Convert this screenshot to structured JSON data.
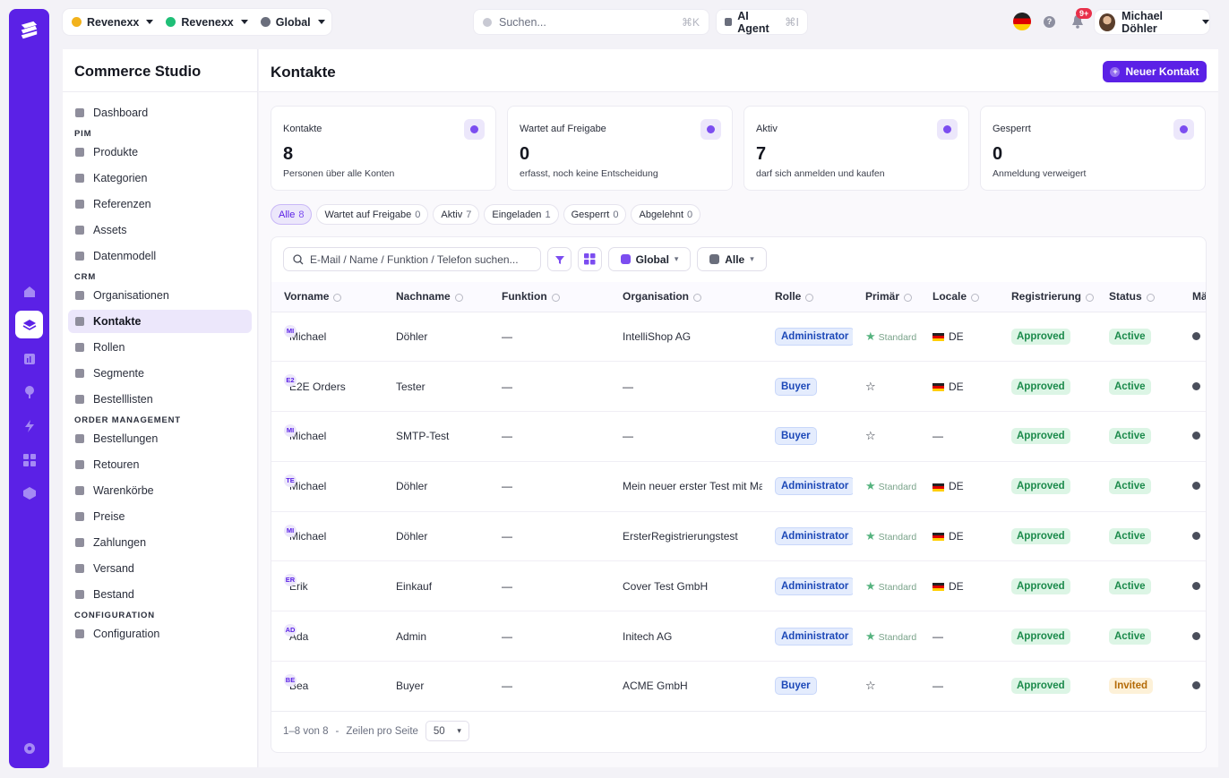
{
  "topbar": {
    "scopes": [
      {
        "label": "Revenexx",
        "color": "#f2b21c"
      },
      {
        "label": "Revenexx",
        "color": "#1fbf77"
      },
      {
        "label": "Global",
        "color": "#6a6e7c"
      }
    ],
    "search_placeholder": "Suchen...",
    "search_shortcut": "⌘K",
    "agent_label": "AI Agent",
    "agent_shortcut": "⌘I",
    "help_label": "?",
    "notifications_badge": "9+",
    "user_name": "Michael Döhler"
  },
  "sidebar": {
    "title": "Commerce Studio",
    "top_items": [
      {
        "label": "Dashboard"
      }
    ],
    "sections": [
      {
        "title": "PIM",
        "items": [
          "Produkte",
          "Kategorien",
          "Referenzen",
          "Assets",
          "Datenmodell"
        ]
      },
      {
        "title": "CRM",
        "items": [
          "Organisationen",
          "Kontakte",
          "Rollen",
          "Segmente",
          "Bestelllisten"
        ]
      },
      {
        "title": "ORDER MANAGEMENT",
        "items": [
          "Bestellungen",
          "Retouren",
          "Warenkörbe",
          "Preise",
          "Zahlungen",
          "Versand",
          "Bestand"
        ]
      },
      {
        "title": "CONFIGURATION",
        "items": [
          "Configuration"
        ]
      }
    ],
    "active": "Kontakte"
  },
  "page": {
    "title": "Kontakte",
    "new_button": "Neuer Kontakt"
  },
  "stats": [
    {
      "label": "Kontakte",
      "value": "8",
      "sub": "Personen über alle Konten"
    },
    {
      "label": "Wartet auf Freigabe",
      "value": "0",
      "sub": "erfasst, noch keine Entscheidung"
    },
    {
      "label": "Aktiv",
      "value": "7",
      "sub": "darf sich anmelden und kaufen"
    },
    {
      "label": "Gesperrt",
      "value": "0",
      "sub": "Anmeldung verweigert"
    }
  ],
  "tabs": [
    {
      "label": "Alle",
      "count": "8",
      "active": true
    },
    {
      "label": "Wartet auf Freigabe",
      "count": "0"
    },
    {
      "label": "Aktiv",
      "count": "7"
    },
    {
      "label": "Eingeladen",
      "count": "1"
    },
    {
      "label": "Gesperrt",
      "count": "0"
    },
    {
      "label": "Abgelehnt",
      "count": "0"
    }
  ],
  "toolbar": {
    "search_placeholder": "E-Mail / Name / Funktion / Telefon suchen...",
    "scope_label": "Global",
    "store_label": "Alle"
  },
  "table": {
    "columns": [
      "Vorname",
      "Nachname",
      "Funktion",
      "Organisation",
      "Rolle",
      "Primär",
      "Locale",
      "Registrierung",
      "Status",
      "Mä"
    ],
    "rows": [
      {
        "initials": "MI",
        "first": "Michael",
        "last": "Döhler",
        "function": "—",
        "org": "IntelliShop AG",
        "role": "Administrator",
        "primary": true,
        "primary_label": "Standard",
        "locale": "DE",
        "registration": "Approved",
        "status": "Active"
      },
      {
        "initials": "E2",
        "first": "E2E Orders",
        "last": "Tester",
        "function": "—",
        "org": "—",
        "role": "Buyer",
        "primary": false,
        "primary_label": "",
        "locale": "DE",
        "registration": "Approved",
        "status": "Active"
      },
      {
        "initials": "MI",
        "first": "Michael",
        "last": "SMTP-Test",
        "function": "—",
        "org": "—",
        "role": "Buyer",
        "primary": false,
        "primary_label": "",
        "locale": "—",
        "registration": "Approved",
        "status": "Active"
      },
      {
        "initials": "TE",
        "first": "Michael",
        "last": "Döhler",
        "function": "—",
        "org": "Mein neuer erster Test mit Mail",
        "role": "Administrator",
        "primary": true,
        "primary_label": "Standard",
        "locale": "DE",
        "registration": "Approved",
        "status": "Active"
      },
      {
        "initials": "MI",
        "first": "Michael",
        "last": "Döhler",
        "function": "—",
        "org": "ErsterRegistrierungstest",
        "role": "Administrator",
        "primary": true,
        "primary_label": "Standard",
        "locale": "DE",
        "registration": "Approved",
        "status": "Active"
      },
      {
        "initials": "ER",
        "first": "Erik",
        "last": "Einkauf",
        "function": "—",
        "org": "Cover Test GmbH",
        "role": "Administrator",
        "primary": true,
        "primary_label": "Standard",
        "locale": "DE",
        "registration": "Approved",
        "status": "Active"
      },
      {
        "initials": "AD",
        "first": "Ada",
        "last": "Admin",
        "function": "—",
        "org": "Initech AG",
        "role": "Administrator",
        "primary": true,
        "primary_label": "Standard",
        "locale": "—",
        "registration": "Approved",
        "status": "Active"
      },
      {
        "initials": "BE",
        "first": "Bea",
        "last": "Buyer",
        "function": "—",
        "org": "ACME GmbH",
        "role": "Buyer",
        "primary": false,
        "primary_label": "",
        "locale": "—",
        "registration": "Approved",
        "status": "Invited"
      }
    ]
  },
  "footer": {
    "range": "1–8 von 8",
    "sep": "-",
    "per_page_label": "Zeilen pro Seite",
    "per_page_value": "50"
  }
}
